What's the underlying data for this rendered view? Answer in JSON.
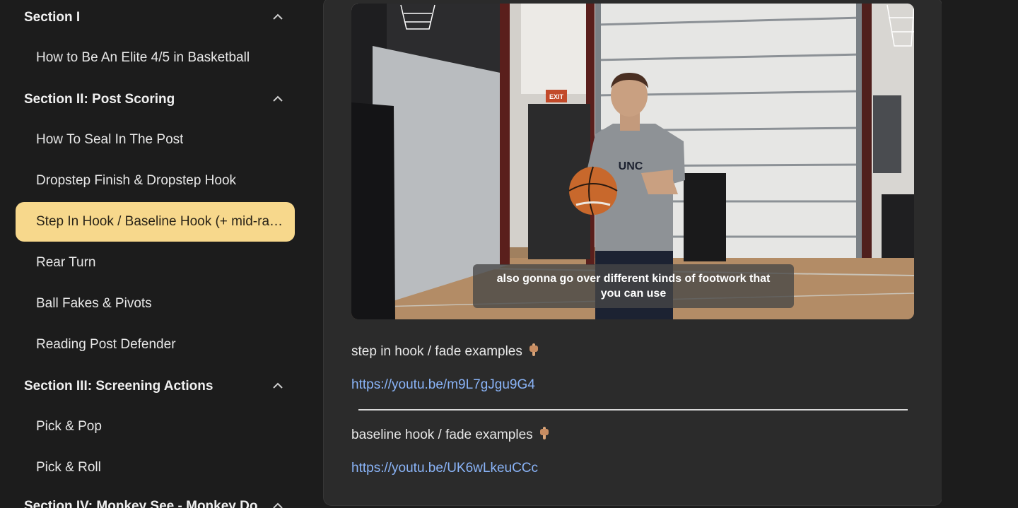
{
  "sidebar": {
    "sections": [
      {
        "title": "Section I",
        "lessons": [
          {
            "label": "How to Be An Elite 4/5 in Basketball"
          }
        ]
      },
      {
        "title": "Section II: Post Scoring",
        "lessons": [
          {
            "label": "How To Seal In The Post"
          },
          {
            "label": "Dropstep Finish & Dropstep Hook"
          },
          {
            "label": "Step In Hook / Baseline Hook (+ mid-range)",
            "active": true
          },
          {
            "label": "Rear Turn"
          },
          {
            "label": "Ball Fakes & Pivots"
          },
          {
            "label": "Reading Post Defender"
          }
        ]
      },
      {
        "title": "Section III: Screening Actions",
        "lessons": [
          {
            "label": "Pick & Pop"
          },
          {
            "label": "Pick & Roll"
          }
        ]
      },
      {
        "title": "Section IV: Monkey See - Monkey Do",
        "lessons": []
      }
    ]
  },
  "main": {
    "video": {
      "caption_line1": "also gonna go over different kinds of footwork that",
      "caption_line2": "you can use",
      "jersey_text": "UNC",
      "exit_sign": "EXIT"
    },
    "step_in_text": "step in hook / fade examples",
    "step_in_link": "https://youtu.be/m9L7gJgu9G4",
    "baseline_text": "baseline hook / fade examples",
    "baseline_link": "https://youtu.be/UK6wLkeuCCc",
    "emoji_icon": "pointing-down-hand-icon"
  },
  "colors": {
    "background": "#1c1c1c",
    "card": "#2b2b2b",
    "active_lesson": "#f7d88c",
    "link": "#8ab4f8"
  }
}
